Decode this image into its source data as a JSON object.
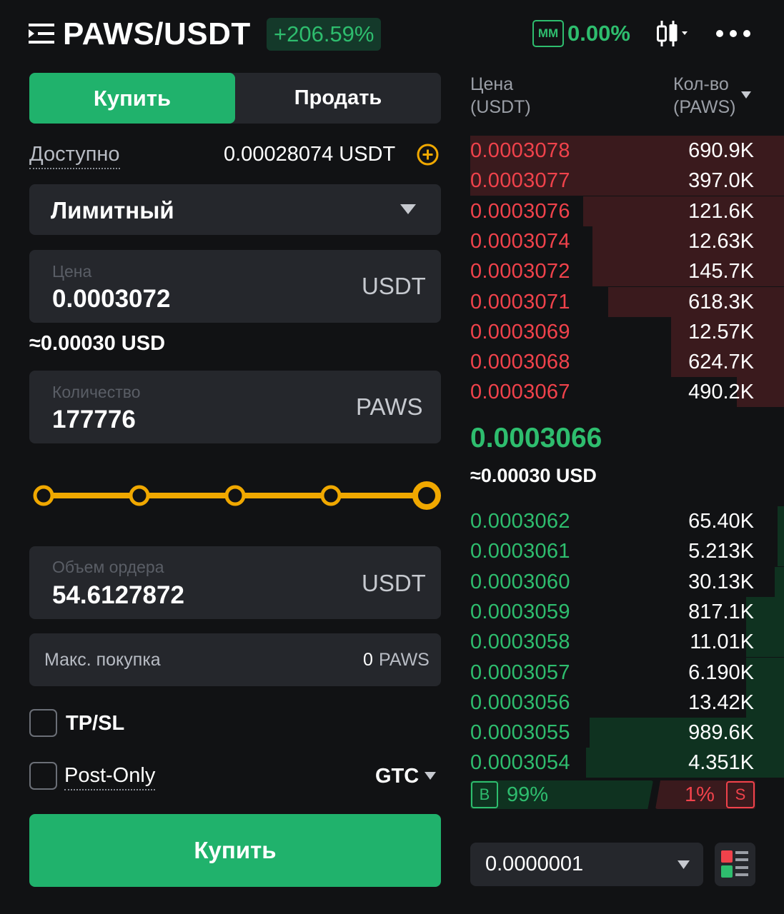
{
  "header": {
    "pair": "PAWS/USDT",
    "change": "+206.59%",
    "mm_badge": "MM",
    "mm_value": "0.00%",
    "icons": [
      "menu-icon",
      "candlestick-icon",
      "more-icon"
    ]
  },
  "tabs": {
    "buy": "Купить",
    "sell": "Продать"
  },
  "available": {
    "label": "Доступно",
    "value": "0.00028074 USDT",
    "icon": "add-funds-icon"
  },
  "order_type": {
    "value": "Лимитный"
  },
  "price_field": {
    "placeholder": "Цена",
    "value": "0.0003072",
    "unit": "USDT"
  },
  "price_usd": "≈0.00030 USD",
  "qty_field": {
    "placeholder": "Количество",
    "value": "177776",
    "unit": "PAWS"
  },
  "slider": {
    "steps": [
      0,
      25,
      50,
      75,
      100
    ],
    "value_percent": 100
  },
  "volume_field": {
    "placeholder": "Объем ордера",
    "value": "54.6127872",
    "unit": "USDT"
  },
  "max_buy": {
    "label": "Макс. покупка",
    "value": "0",
    "unit": "PAWS"
  },
  "options": {
    "tpsl": "TP/SL",
    "post_only": "Post-Only",
    "tif": "GTC"
  },
  "buy_button": "Купить",
  "orderbook": {
    "price_header": [
      "Цена",
      "(USDT)"
    ],
    "qty_header": [
      "Кол-во",
      "(PAWS)"
    ],
    "asks": [
      {
        "price": "0.0003078",
        "qty": "690.9K",
        "depth": 1.0
      },
      {
        "price": "0.0003077",
        "qty": "397.0K",
        "depth": 1.0
      },
      {
        "price": "0.0003076",
        "qty": "121.6K",
        "depth": 0.64
      },
      {
        "price": "0.0003074",
        "qty": "12.63K",
        "depth": 0.61
      },
      {
        "price": "0.0003072",
        "qty": "145.7K",
        "depth": 0.61
      },
      {
        "price": "0.0003071",
        "qty": "618.3K",
        "depth": 0.56
      },
      {
        "price": "0.0003069",
        "qty": "12.57K",
        "depth": 0.36
      },
      {
        "price": "0.0003068",
        "qty": "624.7K",
        "depth": 0.36
      },
      {
        "price": "0.0003067",
        "qty": "490.2K",
        "depth": 0.15
      }
    ],
    "last_price": "0.0003066",
    "last_usd": "≈0.00030 USD",
    "bids": [
      {
        "price": "0.0003062",
        "qty": "65.40K",
        "depth": 0.02
      },
      {
        "price": "0.0003061",
        "qty": "5.213K",
        "depth": 0.02
      },
      {
        "price": "0.0003060",
        "qty": "30.13K",
        "depth": 0.03
      },
      {
        "price": "0.0003059",
        "qty": "817.1K",
        "depth": 0.12
      },
      {
        "price": "0.0003058",
        "qty": "11.01K",
        "depth": 0.12
      },
      {
        "price": "0.0003057",
        "qty": "6.190K",
        "depth": 0.12
      },
      {
        "price": "0.0003056",
        "qty": "13.42K",
        "depth": 0.12
      },
      {
        "price": "0.0003055",
        "qty": "989.6K",
        "depth": 0.62
      },
      {
        "price": "0.0003054",
        "qty": "4.351K",
        "depth": 0.63
      }
    ],
    "ratio": {
      "buy_label": "B",
      "buy_pct": "99%",
      "sell_pct": "1%",
      "sell_label": "S"
    },
    "precision": "0.0000001"
  },
  "colors": {
    "green": "#2ebd6e",
    "red": "#f0424b",
    "accent_yellow": "#f0a800",
    "button_green": "#20b26c"
  }
}
